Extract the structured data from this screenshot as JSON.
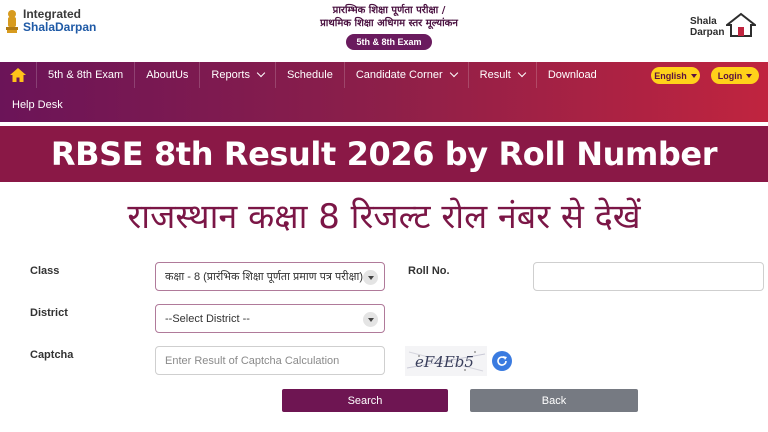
{
  "header": {
    "logo_line1": "Integrated",
    "logo_line2": "ShalaDarpan",
    "hindi_line1": "प्रारम्भिक शिक्षा पूर्णता परीक्षा /",
    "hindi_line2": "प्राथमिक शिक्षा अधिगम स्तर मूल्यांकन",
    "exam_badge": "5th & 8th Exam",
    "right_logo_line1": "Shala",
    "right_logo_line2": "Darpan"
  },
  "nav": {
    "items": [
      {
        "label": "5th & 8th Exam",
        "has_dropdown": false
      },
      {
        "label": "AboutUs",
        "has_dropdown": false
      },
      {
        "label": "Reports",
        "has_dropdown": true
      },
      {
        "label": "Schedule",
        "has_dropdown": false
      },
      {
        "label": "Candidate Corner",
        "has_dropdown": true
      },
      {
        "label": "Result",
        "has_dropdown": true
      },
      {
        "label": "Download",
        "has_dropdown": false
      }
    ],
    "second_row": "Help Desk",
    "language_button": "English",
    "login_button": "Login"
  },
  "banner": {
    "title": "RBSE 8th Result 2026 by Roll Number",
    "subtitle": "राजस्थान कक्षा 8 रिजल्ट रोल नंबर से देखें"
  },
  "form": {
    "class_label": "Class",
    "class_value": "कक्षा - 8 (प्रारंभिक शिक्षा पूर्णता प्रमाण पत्र परीक्षा)",
    "district_label": "District",
    "district_value": "--Select District --",
    "captcha_label": "Captcha",
    "captcha_placeholder": "Enter Result of Captcha Calculation",
    "captcha_text": "eF4Eb5",
    "roll_label": "Roll No.",
    "roll_value": "",
    "search_button": "Search",
    "back_button": "Back"
  },
  "colors": {
    "brand": "#6b1458",
    "accent": "#c0243f",
    "title_bar": "#8a1846",
    "pill": "#ffd21a"
  }
}
